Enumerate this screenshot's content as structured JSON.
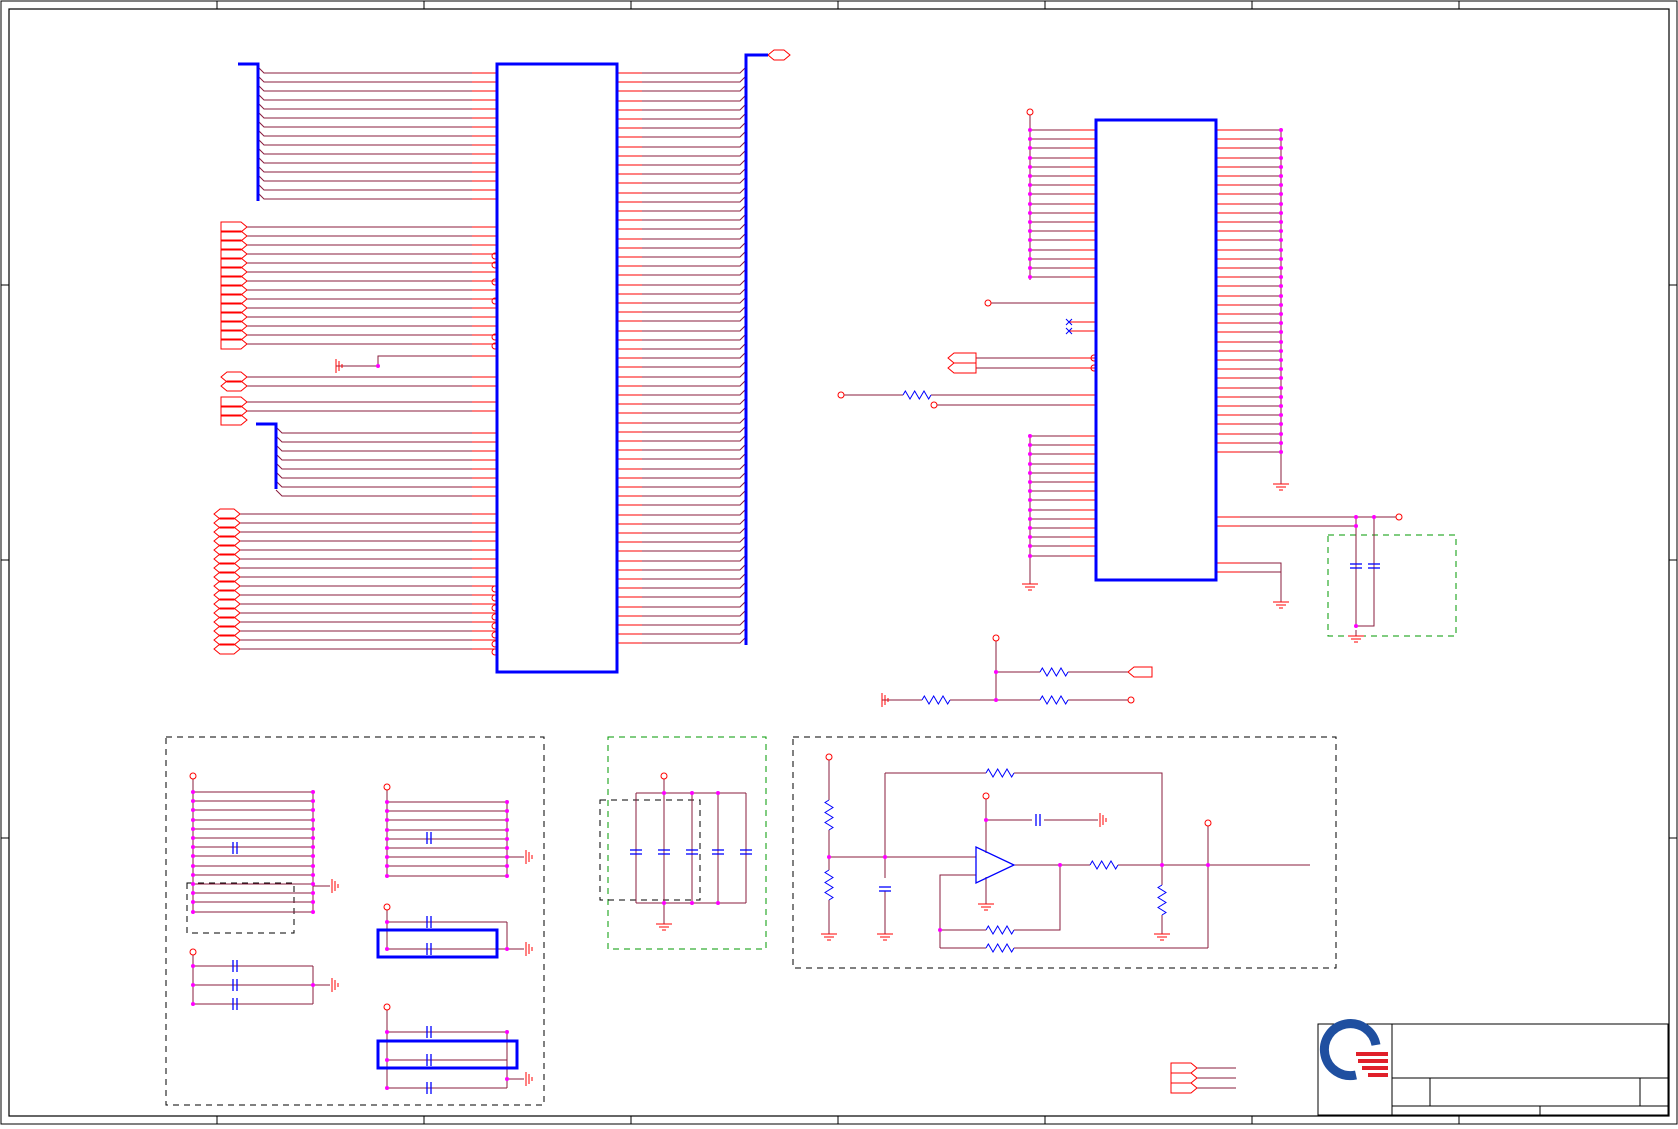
{
  "colors": {
    "border": "#000000",
    "wire": "#8a1c3c",
    "pin": "#ff0000",
    "component": "#0000ff",
    "bus": "#0000ff",
    "junction": "#ff00ff",
    "group_black": "#000000",
    "group_green": "#009900",
    "logo_blue": "#1f4fa0",
    "logo_red": "#e0202a"
  },
  "icons": {
    "ground": "ground-icon",
    "chassis_ground": "chassis-ground-icon",
    "resistor": "resistor-icon",
    "capacitor": "capacitor-icon",
    "opamp": "opamp-icon",
    "power_port": "power-port-icon",
    "offsheet_port": "offsheet-connector-icon",
    "no_connect": "no-connect-icon",
    "logo": "company-logo-icon"
  },
  "title_block": {
    "logo_text": ""
  }
}
